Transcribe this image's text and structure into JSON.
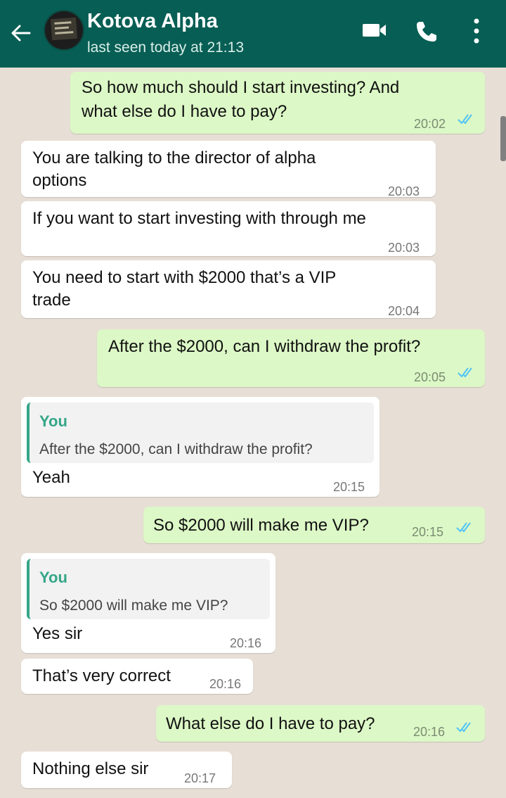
{
  "header": {
    "contact_name": "Kotova Alpha",
    "last_seen": "last seen today at 21:13",
    "icons": [
      "back-arrow-icon",
      "avatar",
      "video-call-icon",
      "voice-call-icon",
      "more-options-icon"
    ]
  },
  "colors": {
    "header": "#075e54",
    "outgoing": "#dcf8c6",
    "incoming": "#ffffff",
    "chat_bg": "#e7dfd6",
    "quote_accent": "#35a688",
    "read_ticks": "#4fc3f7"
  },
  "messages": [
    {
      "direction": "out",
      "lines": [
        "So how much should I start investing? And",
        "what else do I have to pay?"
      ],
      "time": "20:02",
      "status": "read"
    },
    {
      "direction": "in",
      "lines": [
        "You are talking to the director of alpha",
        "options"
      ],
      "time": "20:03"
    },
    {
      "direction": "in",
      "lines": [
        "If you want to start investing with through me"
      ],
      "time": "20:03"
    },
    {
      "direction": "in",
      "lines": [
        "You need to start with $2000 that’s a VIP",
        "trade"
      ],
      "time": "20:04"
    },
    {
      "direction": "out",
      "lines": [
        "After the $2000, can I withdraw the profit?"
      ],
      "time": "20:05",
      "status": "read"
    },
    {
      "direction": "in",
      "quote": {
        "author": "You",
        "text": "After the $2000, can I withdraw the profit?"
      },
      "lines": [
        "Yeah"
      ],
      "time": "20:15"
    },
    {
      "direction": "out",
      "lines": [
        "So $2000 will make me VIP?"
      ],
      "time": "20:15",
      "status": "read"
    },
    {
      "direction": "in",
      "quote": {
        "author": "You",
        "text": "So $2000 will make me VIP?"
      },
      "lines": [
        "Yes sir"
      ],
      "time": "20:16"
    },
    {
      "direction": "in",
      "lines": [
        "That’s very correct"
      ],
      "time": "20:16"
    },
    {
      "direction": "out",
      "lines": [
        "What else do I have to pay?"
      ],
      "time": "20:16",
      "status": "read"
    },
    {
      "direction": "in",
      "lines": [
        "Nothing else sir"
      ],
      "time": "20:17"
    }
  ]
}
